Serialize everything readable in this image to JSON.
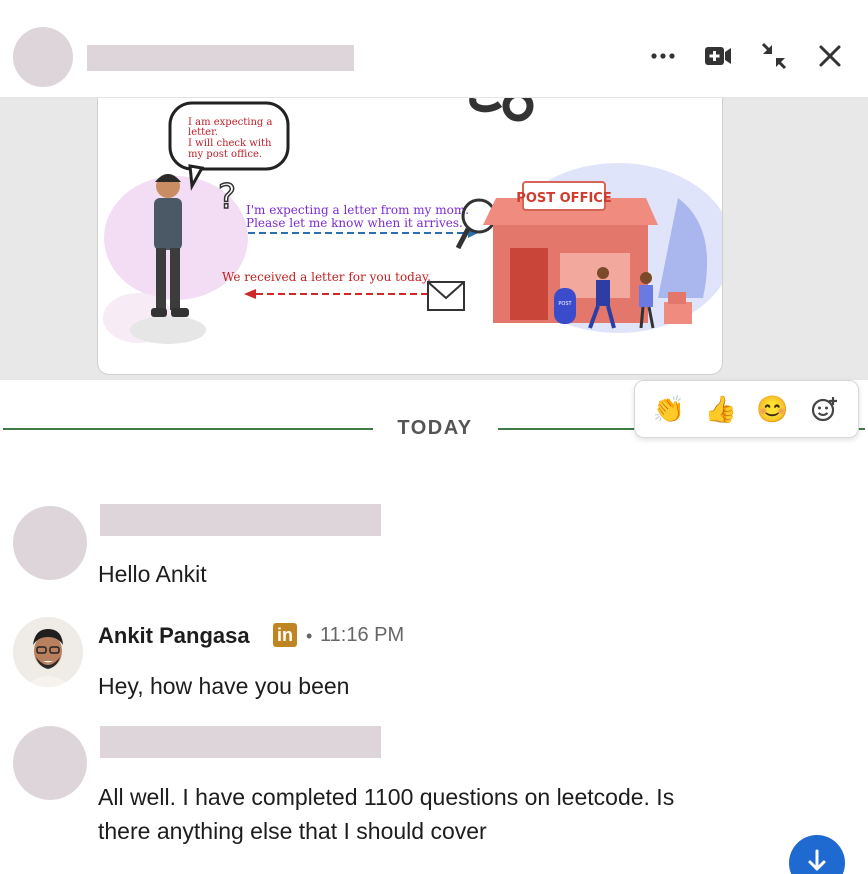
{
  "header": {
    "icons": [
      "more-options-icon",
      "video-call-icon",
      "minimize-icon",
      "close-icon"
    ]
  },
  "media": {
    "thought_bubble": [
      "I am expecting a",
      "letter.",
      "I will check with",
      "my post office."
    ],
    "request_text": [
      "I'm expecting a letter from my mom.",
      "Please let me know when it arrives."
    ],
    "response_text": "We received a letter for you today.",
    "sign": "POST OFFICE",
    "mailbox_label": "POST"
  },
  "divider": {
    "label": "TODAY"
  },
  "reactions": [
    "👏",
    "👍",
    "😊",
    "emoji-add-icon"
  ],
  "messages": [
    {
      "text": "Hello Ankit"
    },
    {
      "sender": "Ankit Pangasa",
      "badge": "in",
      "separator": "•",
      "time": "11:16 PM",
      "text": "Hey, how have you been"
    },
    {
      "lines": [
        "All well. I have completed 1100 questions on leetcode. Is",
        "there anything else that I should cover"
      ]
    }
  ],
  "colors": {
    "accent": "#1f6ad1",
    "divider": "#3e7b46",
    "placeholder": "#ddd5da",
    "badge": "#c08523"
  }
}
